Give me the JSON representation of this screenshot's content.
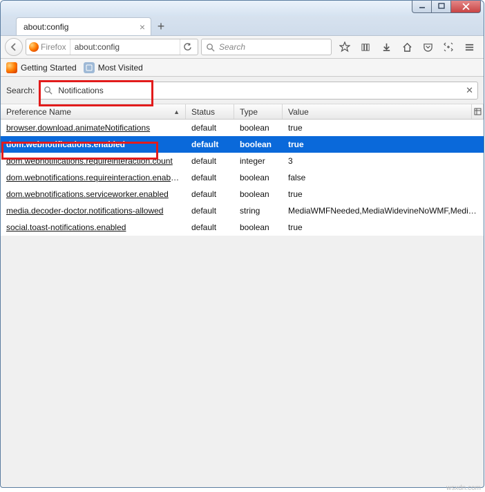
{
  "window": {
    "tab_title": "about:config"
  },
  "navbar": {
    "url_identity": "Firefox",
    "url": "about:config",
    "search_placeholder": "Search"
  },
  "bookmarks": [
    {
      "label": "Getting Started"
    },
    {
      "label": "Most Visited"
    }
  ],
  "config_search": {
    "label": "Search:",
    "value": "Notifications"
  },
  "columns": {
    "name": "Preference Name",
    "status": "Status",
    "type": "Type",
    "value": "Value"
  },
  "rows": [
    {
      "name": "browser.download.animateNotifications",
      "status": "default",
      "type": "boolean",
      "value": "true",
      "selected": false
    },
    {
      "name": "dom.webnotifications.enabled",
      "status": "default",
      "type": "boolean",
      "value": "true",
      "selected": true
    },
    {
      "name": "dom.webnotifications.requireinteraction.count",
      "status": "default",
      "type": "integer",
      "value": "3",
      "selected": false
    },
    {
      "name": "dom.webnotifications.requireinteraction.enabled",
      "status": "default",
      "type": "boolean",
      "value": "false",
      "selected": false
    },
    {
      "name": "dom.webnotifications.serviceworker.enabled",
      "status": "default",
      "type": "boolean",
      "value": "true",
      "selected": false
    },
    {
      "name": "media.decoder-doctor.notifications-allowed",
      "status": "default",
      "type": "string",
      "value": "MediaWMFNeeded,MediaWidevineNoWMF,Media...",
      "selected": false
    },
    {
      "name": "social.toast-notifications.enabled",
      "status": "default",
      "type": "boolean",
      "value": "true",
      "selected": false
    }
  ],
  "watermark": "wsxdn.com"
}
